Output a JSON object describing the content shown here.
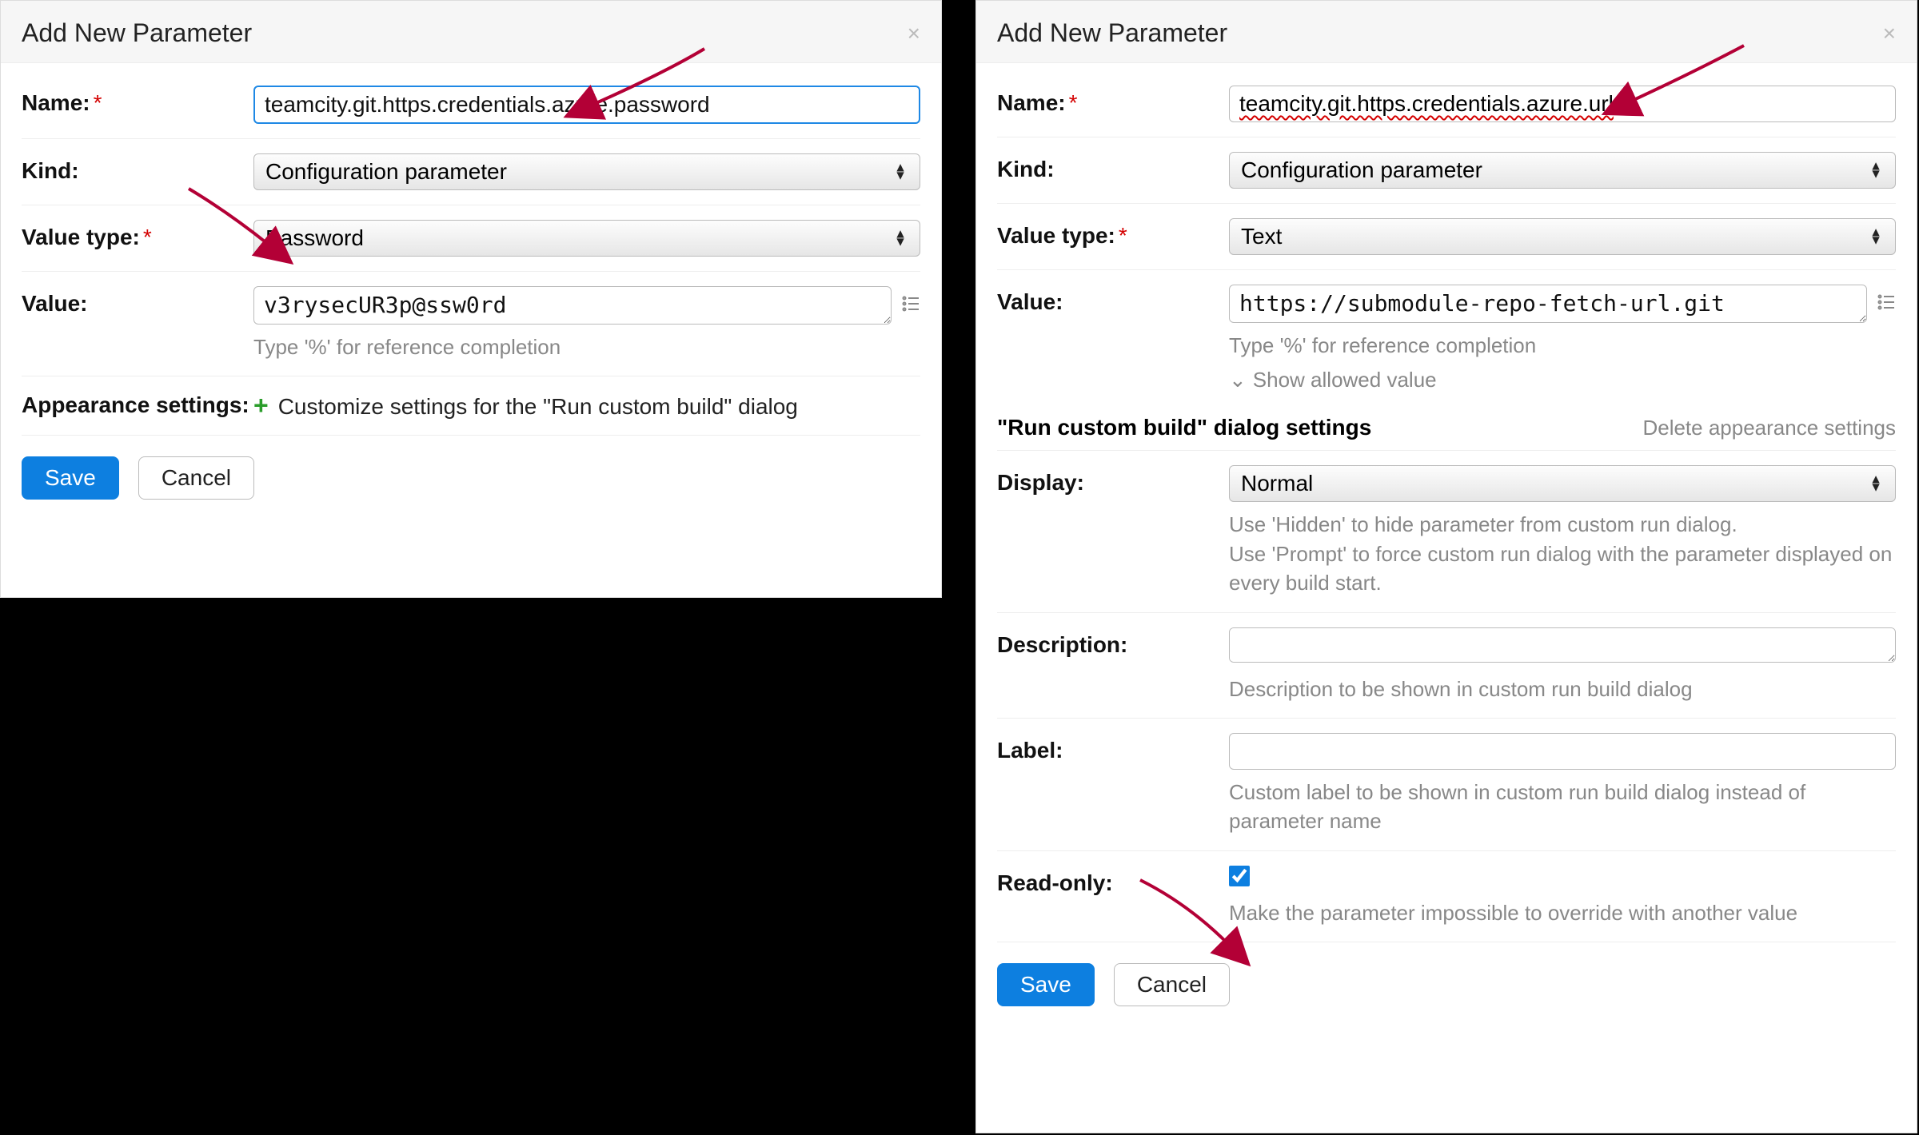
{
  "left": {
    "title": "Add New Parameter",
    "labels": {
      "name": "Name:",
      "kind": "Kind:",
      "valueType": "Value type:",
      "value": "Value:",
      "appearance": "Appearance settings:"
    },
    "name_value": "teamcity.git.https.credentials.azure.password",
    "kind": "Configuration parameter",
    "valueType": "Password",
    "value_value": "v3rysecUR3p@ssw0rd",
    "value_hint": "Type '%' for reference completion",
    "customize_link": "Customize settings for the \"Run custom build\" dialog",
    "save": "Save",
    "cancel": "Cancel",
    "close": "×"
  },
  "right": {
    "title": "Add New Parameter",
    "labels": {
      "name": "Name:",
      "kind": "Kind:",
      "valueType": "Value type:",
      "value": "Value:",
      "display": "Display:",
      "description": "Description:",
      "label": "Label:",
      "readonly": "Read-only:"
    },
    "name_value": "teamcity.git.https.credentials.azure.url",
    "kind": "Configuration parameter",
    "valueType": "Text",
    "value_value": "https://submodule-repo-fetch-url.git",
    "value_hint": "Type '%' for reference completion",
    "show_allowed": "Show allowed value",
    "section_title": "\"Run custom build\" dialog settings",
    "delete_settings": "Delete appearance settings",
    "display": "Normal",
    "display_hint1": "Use 'Hidden' to hide parameter from custom run dialog.",
    "display_hint2": "Use 'Prompt' to force custom run dialog with the parameter displayed on every build start.",
    "description_hint": "Description to be shown in custom run build dialog",
    "label_hint": "Custom label to be shown in custom run build dialog instead of parameter name",
    "readonly_hint": "Make the parameter impossible to override with another value",
    "save": "Save",
    "cancel": "Cancel",
    "close": "×"
  }
}
